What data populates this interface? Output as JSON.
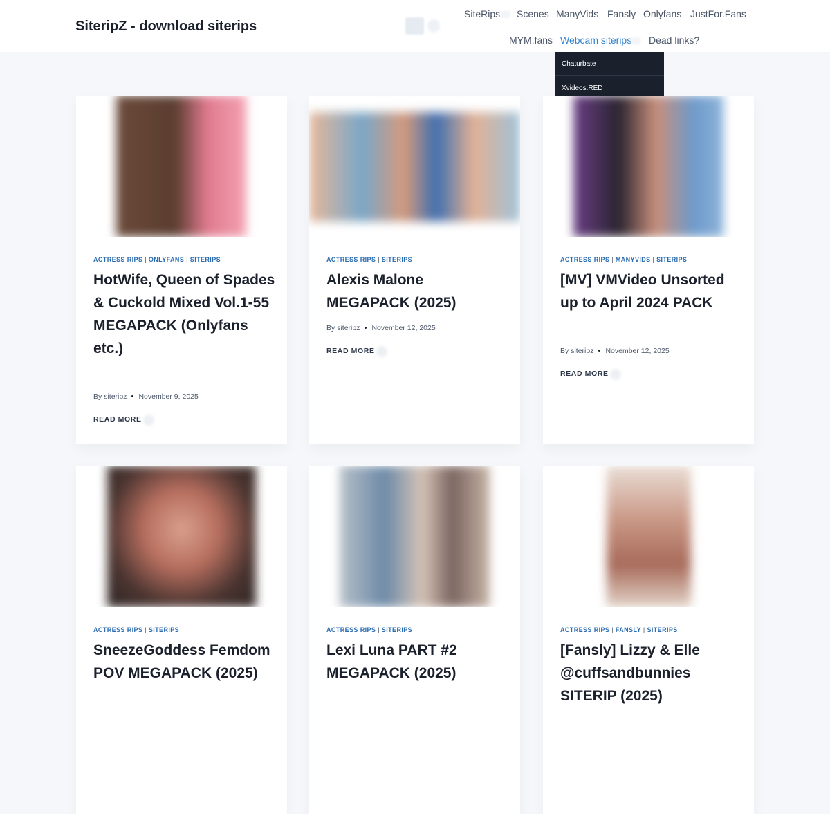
{
  "site": {
    "title": "SiteripZ - download siterips"
  },
  "nav": {
    "row1": [
      "SiteRips",
      "Scenes",
      "ManyVids",
      "Fansly",
      "Onlyfans",
      "JustFor.Fans"
    ],
    "row2": [
      "MYM.fans",
      "Webcam siterips",
      "Dead links?"
    ],
    "active": "Webcam siterips",
    "dropdown": [
      "Chaturbate",
      "Xvideos.RED"
    ]
  },
  "ui": {
    "byline_prefix": "By",
    "read_more": "READ MORE"
  },
  "posts": [
    {
      "categories": [
        "ACTRESS RIPS",
        "ONLYFANS",
        "SITERIPS"
      ],
      "title": "HotWife, Queen of Spades & Cuckold Mixed Vol.1-55 MEGAPACK (Onlyfans etc.)",
      "author": "siteripz",
      "date": "November 9, 2025"
    },
    {
      "categories": [
        "ACTRESS RIPS",
        "SITERIPS"
      ],
      "title": "Alexis Malone MEGAPACK (2025)",
      "author": "siteripz",
      "date": "November 12, 2025"
    },
    {
      "categories": [
        "ACTRESS RIPS",
        "MANYVIDS",
        "SITERIPS"
      ],
      "title": "[MV] VMVideo Unsorted up to April 2024 PACK",
      "author": "siteripz",
      "date": "November 12, 2025"
    },
    {
      "categories": [
        "ACTRESS RIPS",
        "SITERIPS"
      ],
      "title": "SneezeGoddess Femdom POV MEGAPACK (2025)"
    },
    {
      "categories": [
        "ACTRESS RIPS",
        "SITERIPS"
      ],
      "title": "Lexi Luna PART #2 MEGAPACK (2025)"
    },
    {
      "categories": [
        "ACTRESS RIPS",
        "FANSLY",
        "SITERIPS"
      ],
      "title": "[Fansly] Lizzy & Elle @cuffsandbunnies SITERIP (2025)"
    }
  ]
}
